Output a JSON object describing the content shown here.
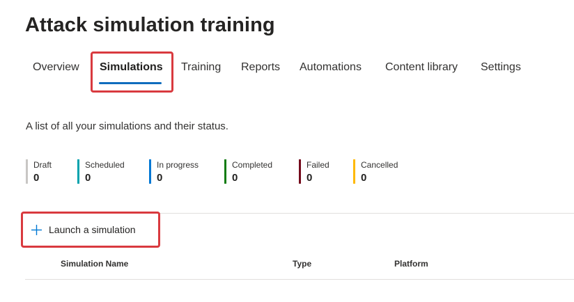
{
  "page": {
    "title": "Attack simulation training",
    "description": "A list of all your simulations and their status."
  },
  "tabs": [
    {
      "label": "Overview",
      "active": false
    },
    {
      "label": "Simulations",
      "active": true
    },
    {
      "label": "Training",
      "active": false
    },
    {
      "label": "Reports",
      "active": false
    },
    {
      "label": "Automations",
      "active": false
    },
    {
      "label": "Content library",
      "active": false
    },
    {
      "label": "Settings",
      "active": false
    }
  ],
  "statuses": [
    {
      "label": "Draft",
      "count": "0",
      "color": "#c8c6c4"
    },
    {
      "label": "Scheduled",
      "count": "0",
      "color": "#00a2ad"
    },
    {
      "label": "In progress",
      "count": "0",
      "color": "#0078d4"
    },
    {
      "label": "Completed",
      "count": "0",
      "color": "#107c10"
    },
    {
      "label": "Failed",
      "count": "0",
      "color": "#750b1c"
    },
    {
      "label": "Cancelled",
      "count": "0",
      "color": "#ffb900"
    }
  ],
  "toolbar": {
    "launch_label": "Launch a simulation",
    "launch_icon": "plus-icon",
    "accent": "#0078d4"
  },
  "table": {
    "columns": [
      "Simulation Name",
      "Type",
      "Platform"
    ]
  },
  "annotations": {
    "highlight_color": "#d93a3f"
  }
}
